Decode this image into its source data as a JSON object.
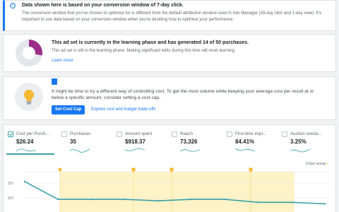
{
  "info": {
    "title": "Data shown here is based on your conversion window of 7-day click.",
    "body": "The conversion window that you've chosen to optimise for is different from the default attribution window used in Ads Manager (28-day click and 1-day view). It's important to use data based on your conversion window when you're deciding how to optimise your performance."
  },
  "learning": {
    "title": "This ad set is currently in the learning phase and has generated 14 of 50 purchases.",
    "body": "This ad set is still in the learning phase. Making significant edits during this time will reset learning.",
    "link": "Learn more",
    "progress": 0.28,
    "ring_color": "#9b2d89",
    "track_color": "#e4e6eb"
  },
  "cost_cap": {
    "body": "It might be time to try a different way of controlling cost. To get the most volume while keeping your average cost per result at or below a specific amount, consider setting a cost cap.",
    "button": "Set Cost Cap",
    "link": "Explore cost and budget trade-offs"
  },
  "metrics": [
    {
      "label": "Cost per Purch...",
      "value": "$26.24",
      "selected": true
    },
    {
      "label": "Purchases",
      "value": "35",
      "selected": false
    },
    {
      "label": "Amount spent",
      "value": "$918.37",
      "selected": false
    },
    {
      "label": "Reach",
      "value": "73,326",
      "selected": false
    },
    {
      "label": "First-time impr...",
      "value": "84.41%",
      "selected": false
    },
    {
      "label": "Auction overla...",
      "value": "3.25%",
      "selected": false
    }
  ],
  "chart": {
    "areas_label": "Chart areas",
    "line_color": "#3aa0a8",
    "area_color": "#fdf3c6",
    "y_ticks": [
      "$50",
      "$40"
    ]
  },
  "chart_data": {
    "type": "line",
    "y_tick_labels": [
      "$50",
      "$40"
    ],
    "series": [
      {
        "values": [
          51,
          39,
          39,
          39,
          38,
          39,
          39,
          37,
          37,
          36
        ]
      }
    ]
  }
}
